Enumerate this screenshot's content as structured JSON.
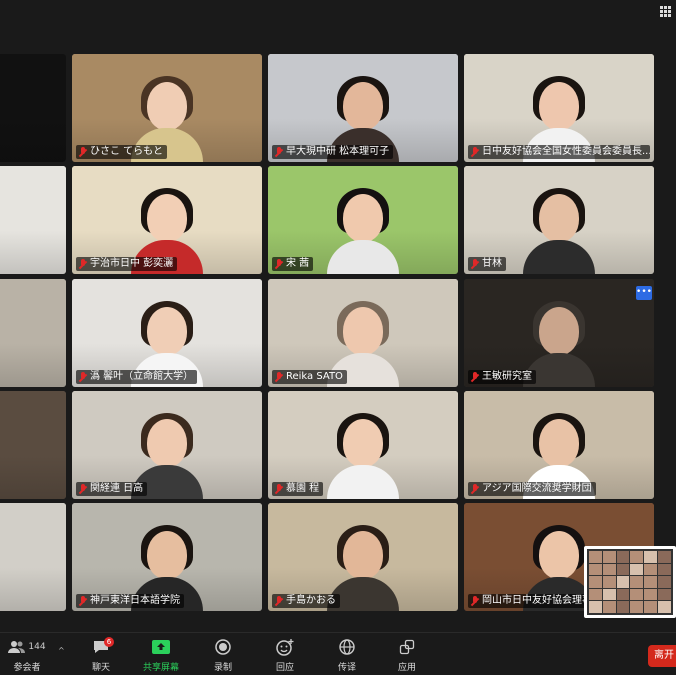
{
  "participants": [
    {
      "name": "",
      "bg": "#111111",
      "skin": "#e9c2a6",
      "hair": "#111111",
      "shirt": "#111111",
      "row": 0,
      "col": 0,
      "partial": true
    },
    {
      "name": "ひさこ てらもと",
      "bg": "#a98a63",
      "skin": "#f0cdb4",
      "hair": "#4a3424",
      "shirt": "#d7c58d",
      "row": 0,
      "col": 1
    },
    {
      "name": "早大現中研  松本理可子",
      "bg": "#c6c8cc",
      "skin": "#e3b79a",
      "hair": "#1a1410",
      "shirt": "#3a2f2b",
      "row": 0,
      "col": 2
    },
    {
      "name": "日中友好協会全国女性委員会委員長...",
      "bg": "#d9d4c8",
      "skin": "#eec7ae",
      "hair": "#1a1410",
      "shirt": "#f2f2f2",
      "row": 0,
      "col": 3
    },
    {
      "name": "",
      "bg": "#e6e4df",
      "skin": "#e9c2a6",
      "hair": "#2a1e16",
      "shirt": "#999999",
      "row": 1,
      "col": 0,
      "partial": true
    },
    {
      "name": "宇治市日中  彭奕灑",
      "bg": "#e7dcc3",
      "skin": "#f2cfb5",
      "hair": "#1a1410",
      "shirt": "#c52a2a",
      "row": 1,
      "col": 1
    },
    {
      "name": "宋  茜",
      "bg": "#9bc66a",
      "skin": "#f0c9ad",
      "hair": "#141010",
      "shirt": "#e8e8e8",
      "row": 1,
      "col": 2
    },
    {
      "name": "甘林",
      "bg": "#d7d2c6",
      "skin": "#e5bfa3",
      "hair": "#1a1410",
      "shirt": "#2c2c2c",
      "row": 1,
      "col": 3
    },
    {
      "name": "",
      "bg": "#b9b2a6",
      "skin": "#e9c2a6",
      "hair": "#1a1410",
      "shirt": "#555555",
      "row": 2,
      "col": 0,
      "partial": true
    },
    {
      "name": "潙  馨叶（立命館大学）",
      "bg": "#e4e2de",
      "skin": "#f0ceb6",
      "hair": "#2a1e16",
      "shirt": "#f5f5f5",
      "row": 2,
      "col": 1
    },
    {
      "name": "Reika SATO",
      "bg": "#cfc8bb",
      "skin": "#eec8ae",
      "hair": "#7a6a5a",
      "shirt": "#e6e1dc",
      "row": 2,
      "col": 2
    },
    {
      "name": "王敏研究室",
      "bg": "#2a2622",
      "skin": "#caa58c",
      "hair": "#3a3530",
      "shirt": "#3a3632",
      "row": 2,
      "col": 3
    },
    {
      "name": "",
      "bg": "#5a4c40",
      "skin": "#e9c2a6",
      "hair": "#1a1410",
      "shirt": "#444444",
      "row": 3,
      "col": 0,
      "partial": true
    },
    {
      "name": "関経連 日高",
      "bg": "#cfcac1",
      "skin": "#efcab0",
      "hair": "#3b2a1e",
      "shirt": "#3a3a3a",
      "row": 3,
      "col": 1
    },
    {
      "name": "慕園 程",
      "bg": "#d4cdc0",
      "skin": "#f0ccb2",
      "hair": "#1a1410",
      "shirt": "#f2f2f2",
      "row": 3,
      "col": 2
    },
    {
      "name": "アジア国際交流奨学財団",
      "bg": "#c8bca8",
      "skin": "#e8c2a6",
      "hair": "#1a1410",
      "shirt": "#ffffff",
      "row": 3,
      "col": 3
    },
    {
      "name": "",
      "bg": "#d2cfc8",
      "skin": "#e9c2a6",
      "hair": "#1a1410",
      "shirt": "#1f1f1f",
      "row": 4,
      "col": 0,
      "partial": true
    },
    {
      "name": "神戸東洋日本語学院",
      "bg": "#b8b6ad",
      "skin": "#e6be9f",
      "hair": "#1a1410",
      "shirt": "#262626",
      "row": 4,
      "col": 1
    },
    {
      "name": "手島かおる",
      "bg": "#c7b99e",
      "skin": "#e2b798",
      "hair": "#2a1e16",
      "shirt": "#3b3630",
      "row": 4,
      "col": 2
    },
    {
      "name": "岡山市日中友好協会理事",
      "bg": "#7a4e33",
      "skin": "#ecc5a8",
      "hair": "#141010",
      "shirt": "#2a2a2a",
      "row": 4,
      "col": 3
    }
  ],
  "toolbar": {
    "participants_label": "参会者",
    "participants_count": "144",
    "chat_label": "聊天",
    "chat_badge": "6",
    "share_label": "共享屏幕",
    "record_label": "录制",
    "reactions_label": "回应",
    "interpret_label": "传译",
    "apps_label": "应用",
    "leave_label": "离开"
  },
  "colors": {
    "background": "#1a1a1a",
    "mic_muted": "#e02828",
    "share_green": "#2bd05b",
    "leave_red": "#d4291c",
    "more_blue": "#2d6be4"
  },
  "more_dots": "•••"
}
